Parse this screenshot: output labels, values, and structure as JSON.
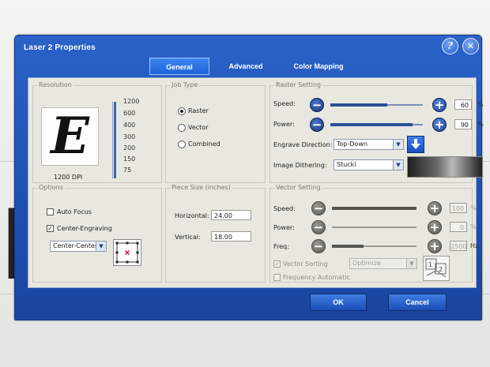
{
  "window": {
    "title": "Laser 2 Properties",
    "help_label": "?",
    "close_label": "✕"
  },
  "tabs": [
    {
      "label": "General"
    },
    {
      "label": "Advanced"
    },
    {
      "label": "Color Mapping"
    }
  ],
  "resolution": {
    "group_title": "Resolution",
    "preview_letter": "E",
    "caption": "1200 DPI",
    "ticks": [
      "1200",
      "600",
      "400",
      "300",
      "200",
      "150",
      "75"
    ]
  },
  "job_type": {
    "group_title": "Job Type",
    "options": [
      {
        "label": "Raster"
      },
      {
        "label": "Vector"
      },
      {
        "label": "Combined"
      }
    ],
    "selected": "Raster"
  },
  "raster": {
    "group_title": "Raster Setting",
    "speed_label": "Speed:",
    "speed_value": "60",
    "power_label": "Power:",
    "power_value": "90",
    "percent": "%",
    "engrave_label": "Engrave Direction:",
    "engrave_value": "Top-Down",
    "dither_label": "Image Dithering:",
    "dither_value": "Stucki"
  },
  "options": {
    "group_title": "Options",
    "auto_focus_label": "Auto Focus",
    "auto_focus_checked": false,
    "center_engraving_label": "Center-Engraving",
    "center_engraving_checked": true,
    "center_mode_value": "Center-Center"
  },
  "piece_size": {
    "group_title": "Piece Size (inches)",
    "horizontal_label": "Horizontal:",
    "horizontal_value": "24.00",
    "vertical_label": "Vertical:",
    "vertical_value": "18.00"
  },
  "vector": {
    "group_title": "Vector Setting",
    "speed_label": "Speed:",
    "speed_value": "100",
    "power_label": "Power:",
    "power_value": "0",
    "freq_label": "Freq:",
    "freq_value": "2500",
    "percent": "%",
    "hz": "Hz",
    "sorting_label": "Vector Sorting",
    "sorting_checked": true,
    "sorting_value": "Optimize",
    "freq_auto_label": "Frequency Automatic",
    "freq_auto_checked": false
  },
  "buttons": {
    "ok": "OK",
    "cancel": "Cancel"
  }
}
